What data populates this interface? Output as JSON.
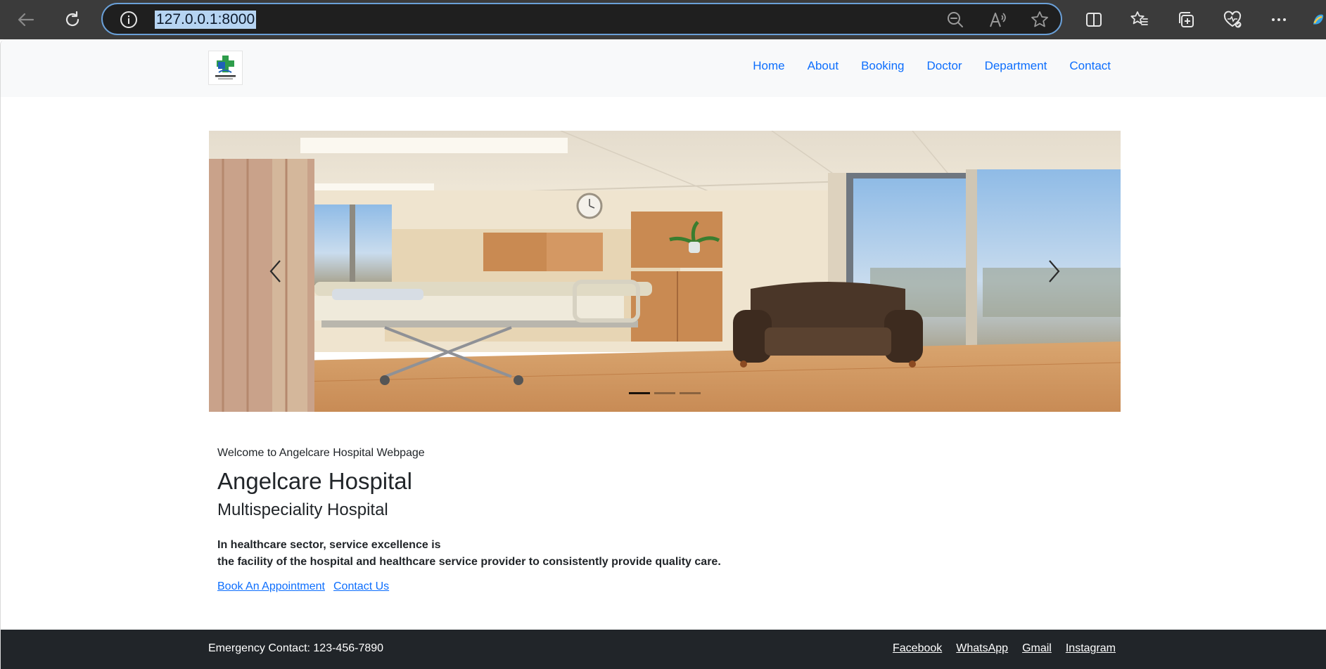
{
  "browser": {
    "url": "127.0.0.1:8000",
    "icons": [
      "back-icon",
      "refresh-icon",
      "info-icon",
      "zoom-out-icon",
      "read-aloud-icon",
      "favorite-star-icon",
      "split-screen-icon",
      "favorites-icon",
      "collections-icon",
      "browser-essentials-icon",
      "more-icon",
      "copilot-icon"
    ]
  },
  "navbar": {
    "links": [
      {
        "label": "Home"
      },
      {
        "label": "About"
      },
      {
        "label": "Booking"
      },
      {
        "label": "Doctor"
      },
      {
        "label": "Department"
      },
      {
        "label": "Contact"
      }
    ]
  },
  "carousel": {
    "slide_count": 3,
    "active_slide": 1
  },
  "hero": {
    "welcome": "Welcome to Angelcare Hospital Webpage",
    "title": "Angelcare Hospital",
    "subtitle": "Multispeciality Hospital",
    "description_line1": "In healthcare sector, service excellence is",
    "description_line2": "the facility of the hospital and healthcare service provider to consistently provide quality care.",
    "book_label": "Book An Appointment",
    "contact_label": "Contact Us"
  },
  "footer": {
    "emergency": "Emergency Contact: 123-456-7890",
    "social": [
      {
        "label": "Facebook"
      },
      {
        "label": "WhatsApp"
      },
      {
        "label": "Gmail"
      },
      {
        "label": "Instagram"
      }
    ]
  },
  "colors": {
    "link": "#0d6efd",
    "footer_bg": "#212529",
    "navbar_bg": "#f8f9fa",
    "chrome_bg": "#3b3b3b"
  }
}
